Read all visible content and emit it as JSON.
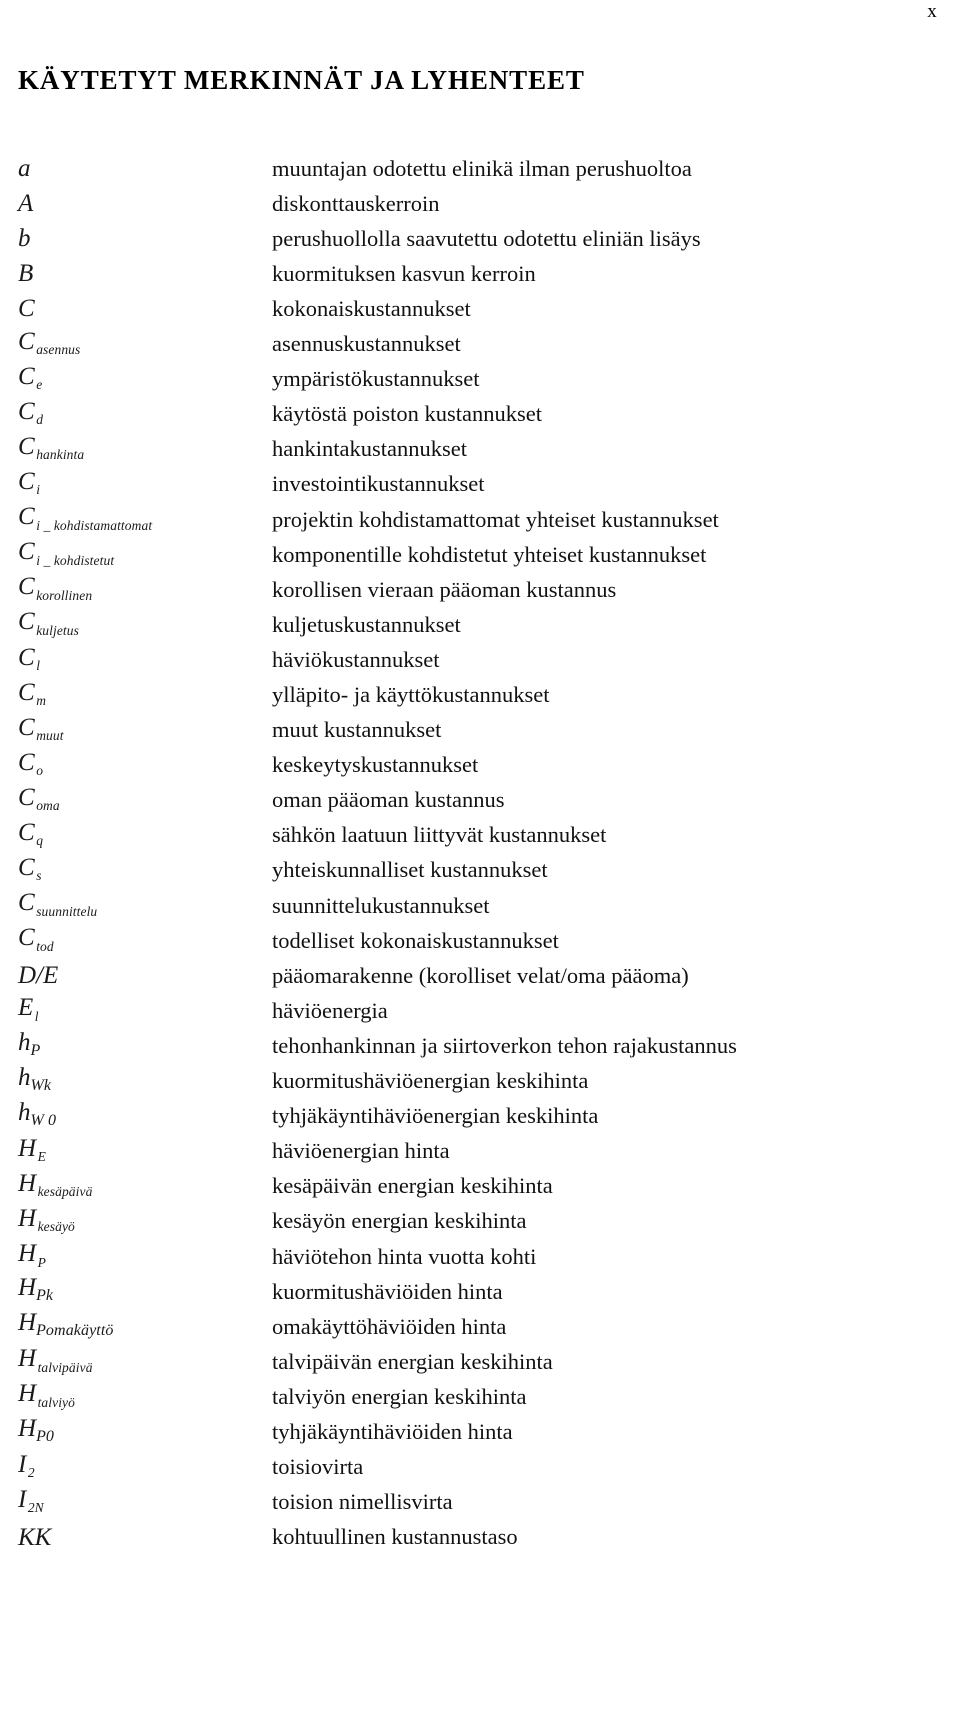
{
  "folio": "x",
  "heading": "KÄYTETYT MERKINNÄT JA LYHENTEET",
  "entries": [
    {
      "base": "a",
      "sub": "",
      "sub_style": "",
      "def": "muuntajan odotettu elinikä ilman perushuoltoa"
    },
    {
      "base": "A",
      "sub": "",
      "sub_style": "",
      "def": "diskonttauskerroin"
    },
    {
      "base": "b",
      "sub": "",
      "sub_style": "",
      "def": "perushuollolla saavutettu odotettu eliniän lisäys"
    },
    {
      "base": "B",
      "sub": "",
      "sub_style": "",
      "def": "kuormituksen kasvun kerroin"
    },
    {
      "base": "C",
      "sub": "",
      "sub_style": "",
      "def": "kokonaiskustannukset"
    },
    {
      "base": "C",
      "sub": "asennus",
      "sub_style": "loose",
      "def": "asennuskustannukset"
    },
    {
      "base": "C",
      "sub": "e",
      "sub_style": "loose",
      "def": "ympäristökustannukset"
    },
    {
      "base": "C",
      "sub": "d",
      "sub_style": "loose",
      "def": "käytöstä poiston kustannukset"
    },
    {
      "base": "C",
      "sub": "hankinta",
      "sub_style": "loose",
      "def": "hankintakustannukset"
    },
    {
      "base": "C",
      "sub": "i",
      "sub_style": "loose",
      "def": "investointikustannukset"
    },
    {
      "base": "C",
      "sub": "i _ kohdistamattomat",
      "sub_style": "loose",
      "def": "projektin kohdistamattomat yhteiset kustannukset"
    },
    {
      "base": "C",
      "sub": "i _ kohdistetut",
      "sub_style": "loose",
      "def": "komponentille kohdistetut yhteiset kustannukset"
    },
    {
      "base": "C",
      "sub": "korollinen",
      "sub_style": "loose",
      "def": "korollisen vieraan pääoman kustannus"
    },
    {
      "base": "C",
      "sub": "kuljetus",
      "sub_style": "loose",
      "def": "kuljetuskustannukset"
    },
    {
      "base": "C",
      "sub": "l",
      "sub_style": "loose",
      "def": "häviökustannukset"
    },
    {
      "base": "C",
      "sub": "m",
      "sub_style": "loose",
      "def": "ylläpito- ja käyttökustannukset"
    },
    {
      "base": "C",
      "sub": "muut",
      "sub_style": "loose",
      "def": "muut kustannukset"
    },
    {
      "base": "C",
      "sub": "o",
      "sub_style": "loose",
      "def": "keskeytyskustannukset"
    },
    {
      "base": "C",
      "sub": "oma",
      "sub_style": "loose",
      "def": "oman pääoman kustannus"
    },
    {
      "base": "C",
      "sub": "q",
      "sub_style": "loose",
      "def": "sähkön laatuun liittyvät kustannukset"
    },
    {
      "base": "C",
      "sub": "s",
      "sub_style": "loose",
      "def": "yhteiskunnalliset kustannukset"
    },
    {
      "base": "C",
      "sub": "suunnittelu",
      "sub_style": "loose",
      "def": "suunnittelukustannukset"
    },
    {
      "base": "C",
      "sub": "tod",
      "sub_style": "loose",
      "def": "todelliset kokonaiskustannukset"
    },
    {
      "base": "D/E",
      "sub": "",
      "sub_style": "",
      "def": "pääomarakenne (korolliset velat/oma pääoma)"
    },
    {
      "base": "E",
      "sub": "l",
      "sub_style": "loose",
      "def": "häviöenergia"
    },
    {
      "base": "h",
      "sub": "P",
      "sub_style": "tight",
      "def": "tehonhankinnan ja siirtoverkon tehon rajakustannus"
    },
    {
      "base": "h",
      "sub": "Wk",
      "sub_style": "tight",
      "def": "kuormitushäviöenergian keskihinta"
    },
    {
      "base": "h",
      "sub": "W 0",
      "sub_style": "tight",
      "def": "tyhjäkäyntihäviöenergian keskihinta"
    },
    {
      "base": "H",
      "sub": "E",
      "sub_style": "loose",
      "def": "häviöenergian hinta"
    },
    {
      "base": "H",
      "sub": "kesäpäivä",
      "sub_style": "loose",
      "def": "kesäpäivän energian keskihinta"
    },
    {
      "base": "H",
      "sub": "kesäyö",
      "sub_style": "loose",
      "def": "kesäyön energian keskihinta"
    },
    {
      "base": "H",
      "sub": "P",
      "sub_style": "loose",
      "def": "häviötehon hinta vuotta kohti"
    },
    {
      "base": "H",
      "sub": "Pk",
      "sub_style": "tight",
      "def": "kuormitushäviöiden hinta"
    },
    {
      "base": "H",
      "sub": "Pomakäyttö",
      "sub_style": "tight",
      "def": "omakäyttöhäviöiden hinta"
    },
    {
      "base": "H",
      "sub": "talvipäivä",
      "sub_style": "loose",
      "def": "talvipäivän energian keskihinta"
    },
    {
      "base": "H",
      "sub": "talviyö",
      "sub_style": "loose",
      "def": "talviyön energian keskihinta"
    },
    {
      "base": "H",
      "sub": "P0",
      "sub_style": "tight",
      "def": "tyhjäkäyntihäviöiden hinta"
    },
    {
      "base": "I",
      "sub": "2",
      "sub_style": "loose",
      "def": "toisiovirta"
    },
    {
      "base": "I",
      "sub": "2N",
      "sub_style": "loose",
      "def": "toision nimellisvirta"
    },
    {
      "base": "KK",
      "sub": "",
      "sub_style": "",
      "def": "kohtuullinen kustannustaso"
    }
  ]
}
